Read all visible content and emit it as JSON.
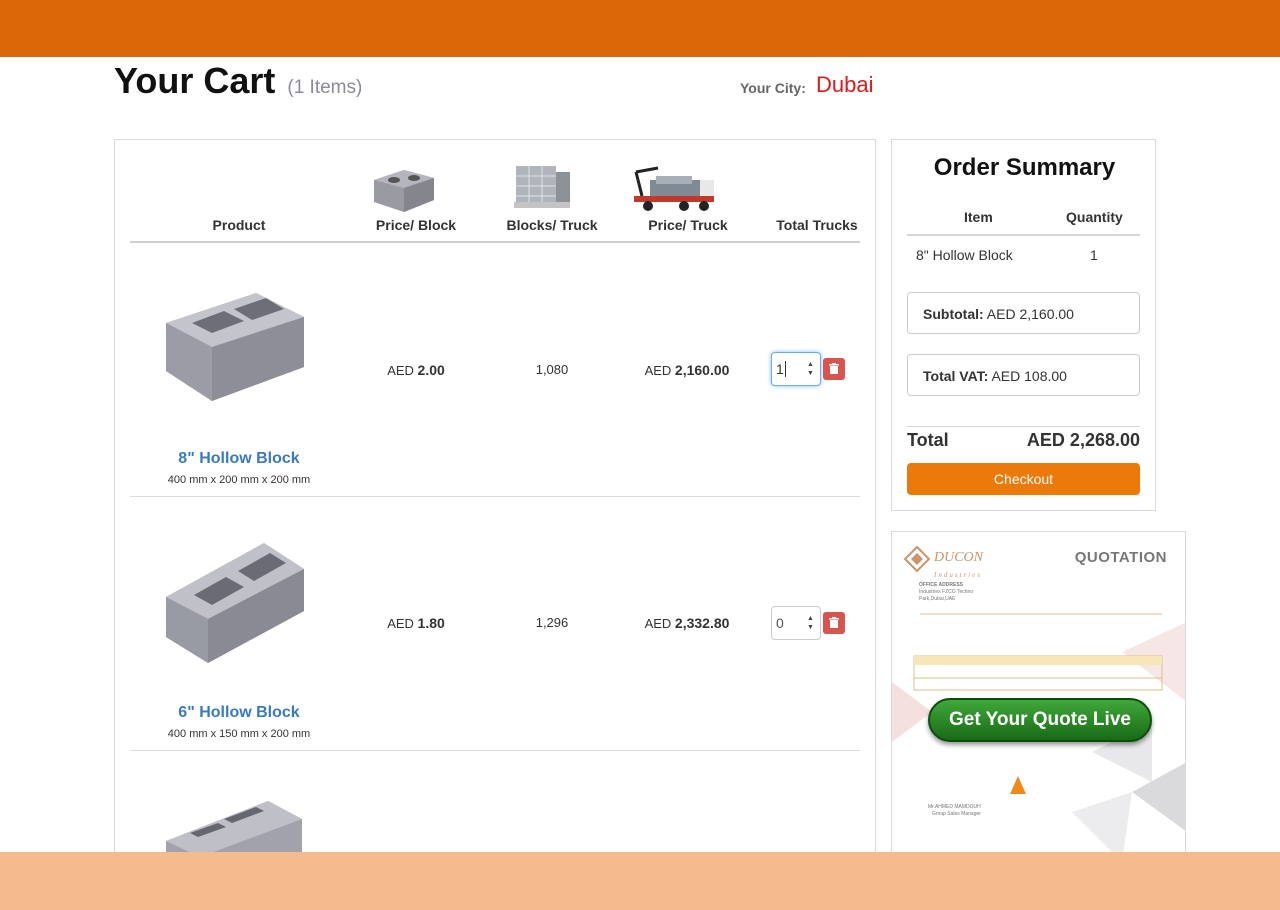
{
  "header": {
    "title": "Your Cart",
    "item_count": "(1 Items)",
    "city_label": "Your City:",
    "city_value": "Dubai"
  },
  "table": {
    "columns": [
      "Product",
      "Price/ Block",
      "Blocks/ Truck",
      "Price/ Truck",
      "Total Trucks"
    ],
    "currency": "AED",
    "rows": [
      {
        "name": "8\" Hollow Block",
        "dims": "400 mm x 200 mm x 200 mm",
        "price_block": "2.00",
        "blocks_truck": "1,080",
        "price_truck": "2,160.00",
        "trucks": "1"
      },
      {
        "name": "6\" Hollow Block",
        "dims": "400 mm x 150 mm x 200 mm",
        "price_block": "1.80",
        "blocks_truck": "1,296",
        "price_truck": "2,332.80",
        "trucks": "0"
      }
    ]
  },
  "summary": {
    "title": "Order Summary",
    "col_item": "Item",
    "col_qty": "Quantity",
    "item_name": "8\" Hollow Block",
    "item_qty": "1",
    "subtotal_label": "Subtotal:",
    "subtotal_value": "AED 2,160.00",
    "vat_label": "Total VAT:",
    "vat_value": "AED 108.00",
    "total_label": "Total",
    "total_value": "AED 2,268.00",
    "checkout_label": "Checkout"
  },
  "quote": {
    "heading": "QUOTATION",
    "logo_text": "DUCON",
    "logo_sub": "Industries",
    "office_label": "OFFICE ADDRESS",
    "office_lines": [
      "Industries FZCO Techno",
      "Park,Dubai,UAE"
    ],
    "signatory": "Mr.AHMED MAMDOUH",
    "signatory_role": "Group Sales Manager",
    "cta_label": "Get Your Quote Live"
  },
  "colors": {
    "brand_orange": "#dc6709",
    "checkout": "#ec7a0b",
    "link_blue": "#3a7bbf",
    "city_red": "#e01818",
    "delete_red": "#d9534f"
  }
}
